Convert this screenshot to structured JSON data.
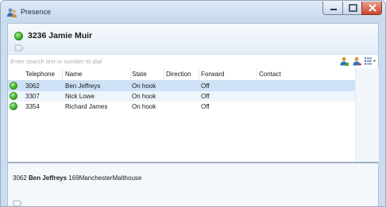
{
  "window": {
    "title": "Presence",
    "app_icon": "presence-people-icon",
    "controls": [
      "minimize-icon",
      "maximize-icon",
      "close-icon"
    ]
  },
  "header": {
    "extension": "3236",
    "name": "Jamie Muir",
    "status_color": "#3fae2a",
    "note_icon": "note-icon"
  },
  "search": {
    "placeholder": "Enter search text or number to dial",
    "value": ""
  },
  "toolbar": {
    "icons": [
      "add-contact-icon",
      "remove-contact-icon",
      "view-options-icon"
    ]
  },
  "table": {
    "columns": [
      "Telephone",
      "Name",
      "State",
      "Direction",
      "Forward",
      "Contact"
    ],
    "rows": [
      {
        "telephone": "3062",
        "name": "Ben Jeffreys",
        "state": "On hook",
        "direction": "",
        "forward": "Off",
        "contact": "",
        "selected": true
      },
      {
        "telephone": "3307",
        "name": "Nick Lowe",
        "state": "On hook",
        "direction": "",
        "forward": "Off",
        "contact": "",
        "selected": false
      },
      {
        "telephone": "3354",
        "name": "Richard James",
        "state": "On hook",
        "direction": "",
        "forward": "Off",
        "contact": "",
        "selected": false
      }
    ]
  },
  "detail": {
    "extension": "3062",
    "name": "Ben Jeffreys",
    "location": "169ManchesterMalthouse"
  },
  "colors": {
    "selected_row": "#cde2f6",
    "available": "#3fae2a",
    "close_button": "#c9452c"
  }
}
